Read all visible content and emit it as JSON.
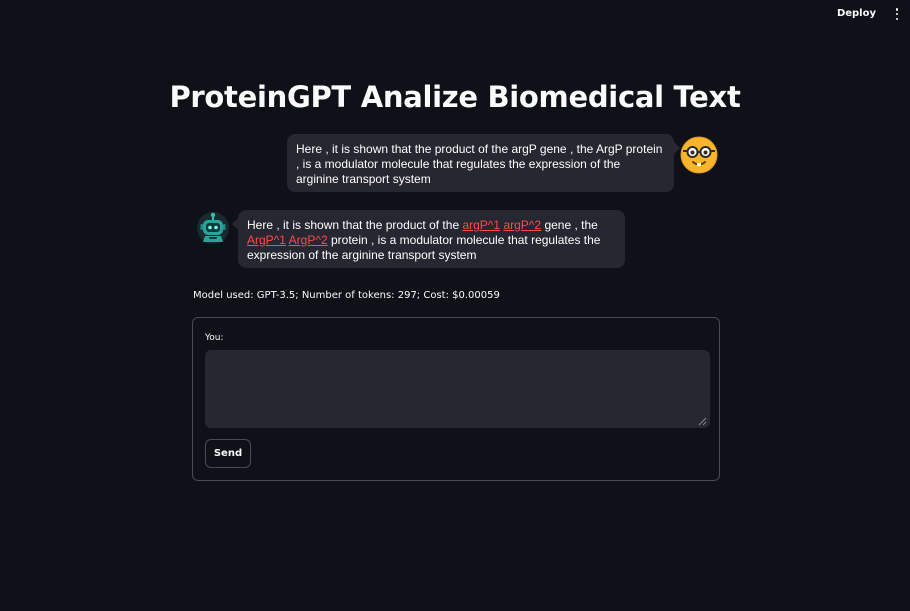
{
  "header": {
    "deploy_label": "Deploy",
    "menu_icon": "kebab-menu-icon"
  },
  "page_title": "ProteinGPT Analize Biomedical Text",
  "chat": {
    "user_message": "Here , it is shown that the product of the argP gene , the ArgP protein , is a modulator molecule that regulates the expression of the arginine transport system",
    "user_avatar_icon": "nerd-face-icon",
    "bot_avatar_icon": "robot-icon",
    "bot_message": {
      "t1": "Here , it is shown that the product of the ",
      "tag1": "argP^1",
      "tag2": "argP^2",
      "t2": " gene , the ",
      "tag3": "ArgP^1",
      "tag4": "ArgP^2",
      "t3": " protein , is a modulator molecule that regulates the expression of the arginine transport system"
    }
  },
  "stats_line": "Model used: GPT-3.5; Number of tokens: 297; Cost: $0.00059",
  "form": {
    "label": "You:",
    "input_value": "",
    "send_label": "Send"
  },
  "colors": {
    "background": "#0e1117",
    "bubble": "#262730",
    "entity_highlight": "#ff4b4b",
    "user_avatar": "#f7b42c",
    "bot_avatar": "#1e8a8a"
  }
}
